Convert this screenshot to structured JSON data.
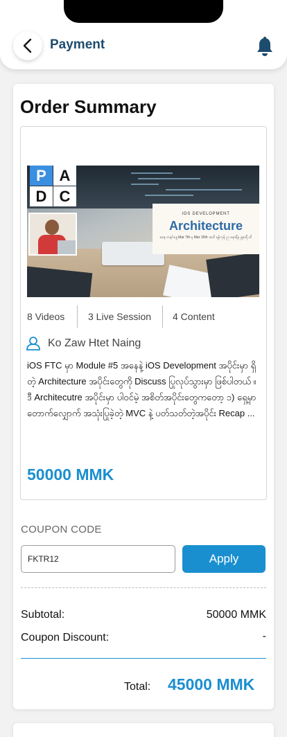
{
  "header": {
    "title": "Payment",
    "back_icon": "chevron-left-icon",
    "bell_icon": "bell-icon"
  },
  "order": {
    "title": "Order Summary"
  },
  "course": {
    "banner": {
      "logo_letters": [
        "P",
        "A",
        "D",
        "C"
      ],
      "subtitle": "IOS DEVELOPMENT",
      "title": "Architecture",
      "note": "စနေ တနင်္ဂနွေ Mar 7th မှ Mar 15th အထိ ရန်ကုန် ည ၈နာရီမှ ၉နာရီ ထိ"
    },
    "stats": [
      "8 Videos",
      "3 Live Session",
      "4 Content"
    ],
    "instructor": "Ko Zaw Htet Naing",
    "description": "iOS FTC မှာ Module #5 အနေနဲ့ iOS Development အပိုင်းမှာ ရှိတဲ့ Architecture အပိုင်းတွေကို Discuss ပြုလုပ်သွားမှာ ဖြစ်ပါတယ် ။ ဒီ Architecutre အပိုင်းမှာ ပါဝင်မဲ့ အစိတ်အပိုင်းတွေကတော့ ၁) ရှေ့မှာ တောက်လျှောက် အသုံးပြုခဲ့တဲ့ MVC နဲ့ ပတ်သတ်တဲ့အပိုင်း Recap ...",
    "price": "50000 MMK"
  },
  "coupon": {
    "label": "COUPON CODE",
    "value": "FKTR12",
    "apply_label": "Apply"
  },
  "summary": {
    "subtotal_label": "Subtotal:",
    "subtotal_value": "50000 MMK",
    "discount_label": "Coupon Discount:",
    "discount_value": "-",
    "total_label": "Total:",
    "total_value": "45000 MMK"
  },
  "colors": {
    "accent": "#1a8fd0",
    "header_title": "#1d4c6e"
  }
}
